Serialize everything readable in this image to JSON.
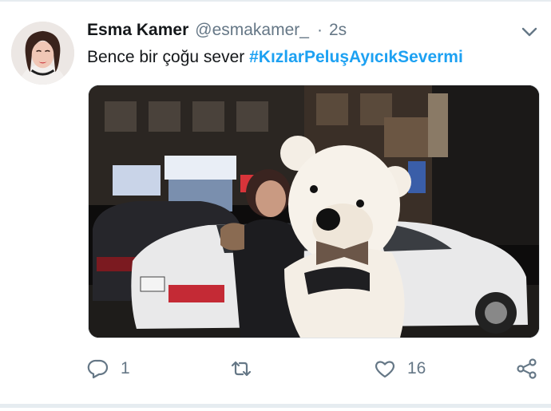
{
  "tweet": {
    "author_name": "Esma Kamer",
    "author_handle": "@esmakamer_",
    "separator": "·",
    "time": "2s",
    "text_prefix": "Bence bir çoğu sever ",
    "hashtag": "#KızlarPeluşAyıcıkSevermi"
  },
  "actions": {
    "reply_count": "1",
    "like_count": "16"
  },
  "icons": {
    "menu": "chevron-down-icon",
    "reply": "reply-icon",
    "retweet": "retweet-icon",
    "like": "heart-icon",
    "share": "share-icon"
  },
  "colors": {
    "link": "#1da1f2",
    "muted": "#657786",
    "text": "#14171a"
  }
}
